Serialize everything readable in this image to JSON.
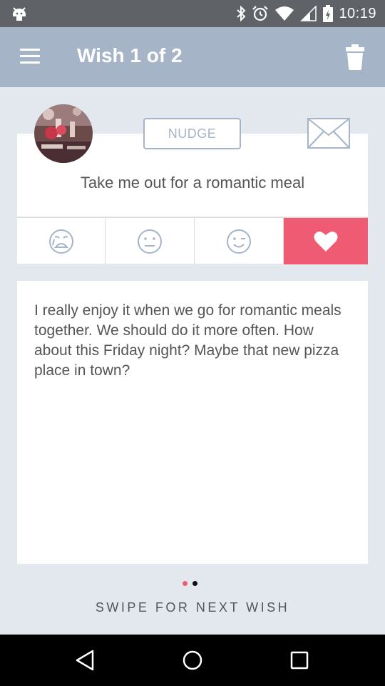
{
  "status_bar": {
    "time": "10:19",
    "icons": [
      "android-debug-icon",
      "bluetooth-icon",
      "alarm-icon",
      "wifi-icon",
      "signal-icon",
      "battery-icon"
    ]
  },
  "app_bar": {
    "title": "Wish 1 of 2",
    "menu_icon": "hamburger-menu-icon",
    "action_icon": "trash-icon"
  },
  "wish": {
    "avatar": "avatar-photo",
    "nudge_label": "NUDGE",
    "message_icon": "envelope-icon",
    "title": "Take me out for a romantic meal",
    "description": "I really enjoy it when we go for romantic meals together. We should do it more often. How about this Friday night? Maybe that new pizza place in town?"
  },
  "reactions": [
    {
      "icon": "crying-face-icon",
      "selected": false
    },
    {
      "icon": "neutral-face-icon",
      "selected": false
    },
    {
      "icon": "winking-face-icon",
      "selected": false
    },
    {
      "icon": "heart-icon",
      "selected": true
    }
  ],
  "pager": {
    "total": 2,
    "current": 1,
    "hint": "SWIPE FOR NEXT WISH"
  },
  "colors": {
    "accent": "#ee5b73",
    "app_bar": "#a6b4c8",
    "background": "#e3e8ef",
    "status_bar": "#5f6368"
  }
}
